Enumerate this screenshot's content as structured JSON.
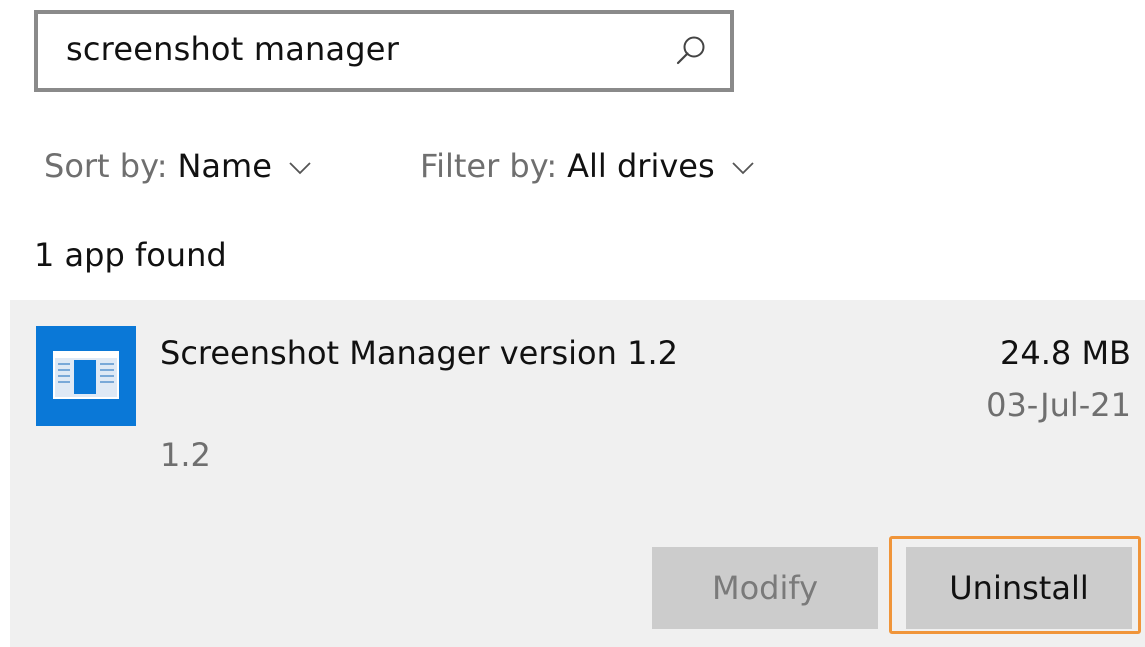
{
  "search": {
    "value": "screenshot manager"
  },
  "sort": {
    "label": "Sort by:",
    "value": "Name"
  },
  "filter": {
    "label": "Filter by:",
    "value": "All drives"
  },
  "results": {
    "count_text": "1 app found"
  },
  "app": {
    "name": "Screenshot Manager version 1.2",
    "version": "1.2",
    "size": "24.8 MB",
    "date": "03-Jul-21",
    "icon_color": "#0a78d7"
  },
  "buttons": {
    "modify_label": "Modify",
    "uninstall_label": "Uninstall"
  },
  "colors": {
    "highlight": "#f0953a",
    "card_background": "#f0f0f0",
    "button_background": "#cccccc"
  }
}
